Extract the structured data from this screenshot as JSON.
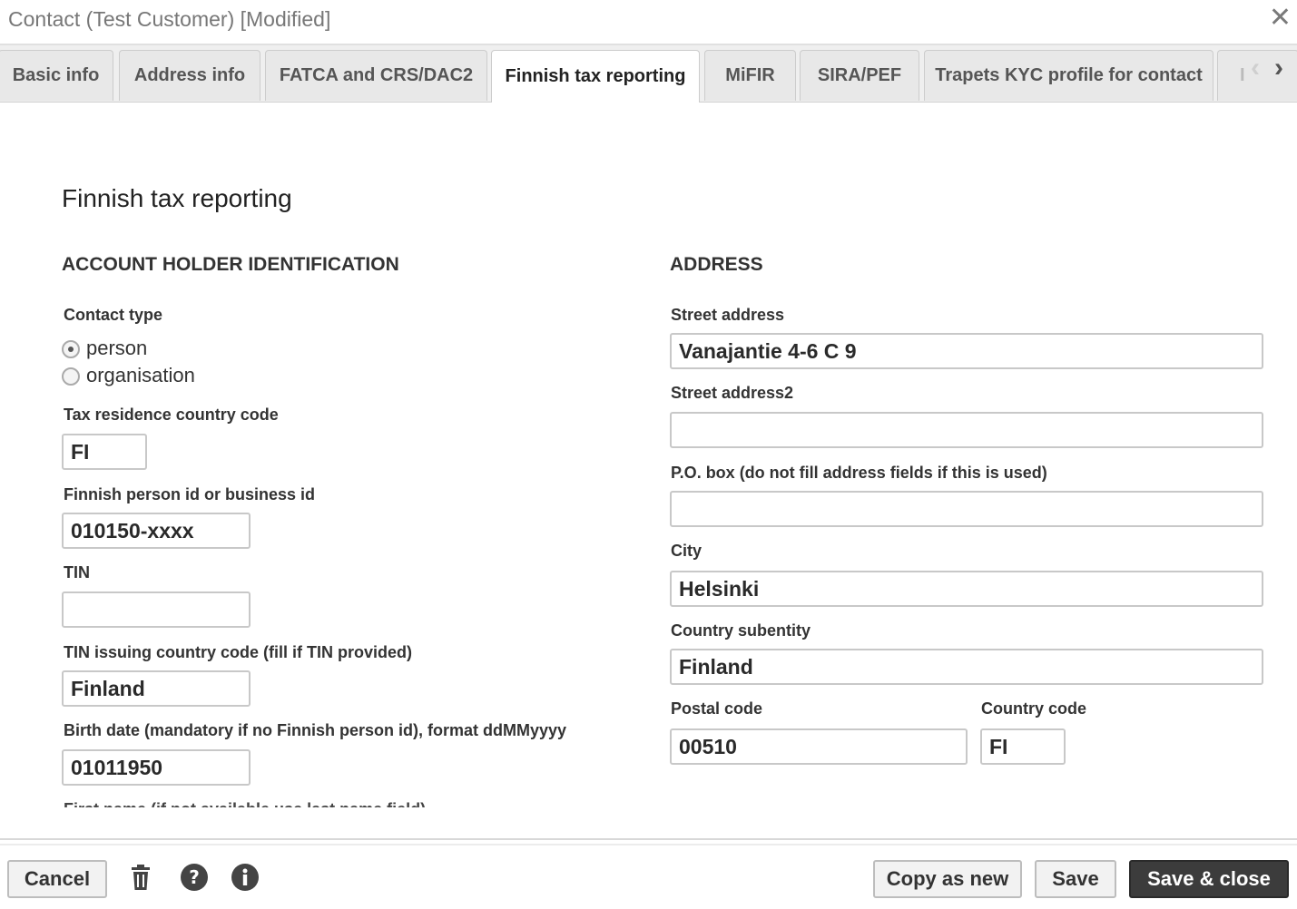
{
  "window": {
    "title": "Contact (Test Customer) [Modified]",
    "close_icon": "close-icon"
  },
  "tabs": [
    {
      "label": "Basic info",
      "active": false
    },
    {
      "label": "Address info",
      "active": false
    },
    {
      "label": "FATCA and CRS/DAC2",
      "active": false
    },
    {
      "label": "Finnish tax reporting",
      "active": true
    },
    {
      "label": "MiFIR",
      "active": false
    },
    {
      "label": "SIRA/PEF",
      "active": false
    },
    {
      "label": "Trapets KYC profile for contact",
      "active": false
    },
    {
      "label": "I",
      "active": false
    }
  ],
  "page": {
    "heading": "Finnish tax reporting",
    "left_section": "ACCOUNT HOLDER IDENTIFICATION",
    "right_section": "ADDRESS"
  },
  "account_holder": {
    "contact_type_label": "Contact type",
    "contact_type_options": [
      "person",
      "organisation"
    ],
    "contact_type_selected": "person",
    "tax_residence_label": "Tax residence country code",
    "tax_residence_value": "FI",
    "person_id_label": "Finnish person id or business id",
    "person_id_value": "010150-xxxx",
    "tin_label": "TIN",
    "tin_value": "",
    "tin_country_label": "TIN issuing country code (fill if TIN provided)",
    "tin_country_value": "Finland",
    "birth_date_label": "Birth date (mandatory if no Finnish person id), format ddMMyyyy",
    "birth_date_value": "01011950",
    "first_name_label_partial": "First name (if not available use last name field)"
  },
  "address": {
    "street_label": "Street address",
    "street_value": "Vanajantie 4-6 C 9",
    "street2_label": "Street address2",
    "street2_value": "",
    "pobox_label": "P.O. box (do not fill address fields if this is used)",
    "pobox_value": "",
    "city_label": "City",
    "city_value": "Helsinki",
    "subentity_label": "Country subentity",
    "subentity_value": "Finland",
    "postal_label": "Postal code",
    "postal_value": "00510",
    "country_code_label": "Country code",
    "country_code_value": "FI"
  },
  "footer": {
    "cancel": "Cancel",
    "copy_as_new": "Copy as new",
    "save": "Save",
    "save_close": "Save & close",
    "icons": [
      "trash-icon",
      "help-icon",
      "info-icon"
    ]
  }
}
